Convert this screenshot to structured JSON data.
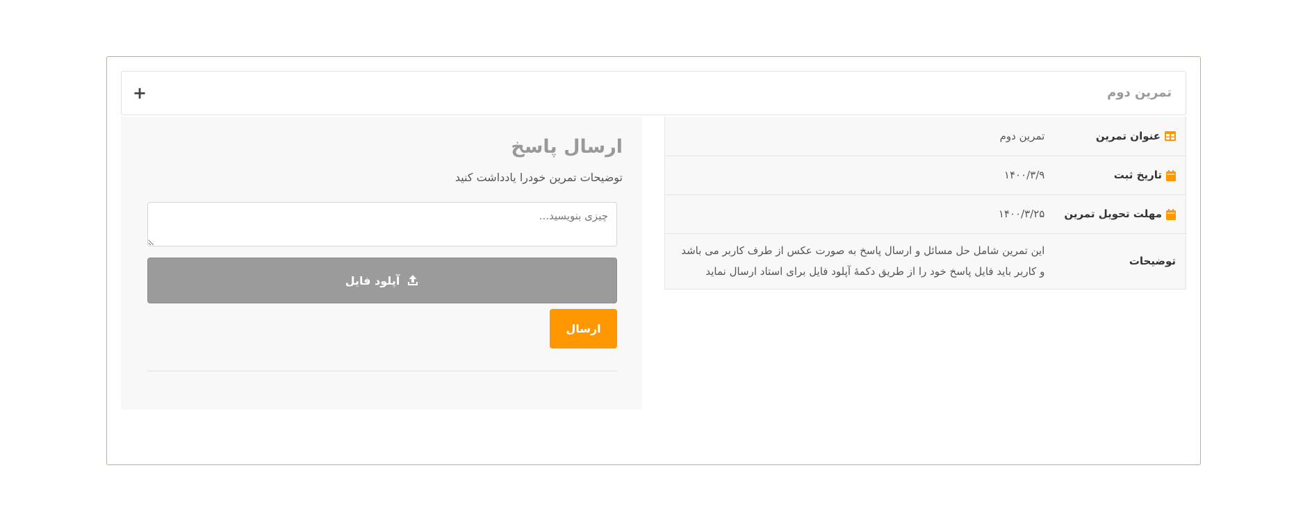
{
  "accordion": {
    "title": "تمرین دوم",
    "toggle_symbol": "+"
  },
  "answer_panel": {
    "title": "ارسال پاسخ",
    "subtitle": "توضیحات تمرین خودرا یادداشت کنید",
    "textarea_placeholder": "چیزی بنویسید...",
    "upload_label": "آپلود فایل",
    "submit_label": "ارسال"
  },
  "details": {
    "rows": [
      {
        "label": "عنوان تمرین",
        "icon": "table-icon",
        "value": "تمرین دوم"
      },
      {
        "label": "تاریخ ثبت",
        "icon": "calendar-icon",
        "value": "۱۴۰۰/۳/۹"
      },
      {
        "label": "مهلت تحویل تمرین",
        "icon": "calendar-icon",
        "value": "۱۴۰۰/۳/۲۵"
      },
      {
        "label": "توضیحات",
        "icon": "",
        "value": "این تمرین شامل حل مسائل و ارسال پاسخ به صورت عکس از طرف کاربر می باشد و کاربر باید فایل پاسخ خود را از طریق دکمهٔ آپلود فایل برای استاد ارسال نماید"
      }
    ]
  },
  "colors": {
    "accent": "#ff9800",
    "card_border": "#f5a623",
    "upload_button": "#9a9b9a"
  }
}
